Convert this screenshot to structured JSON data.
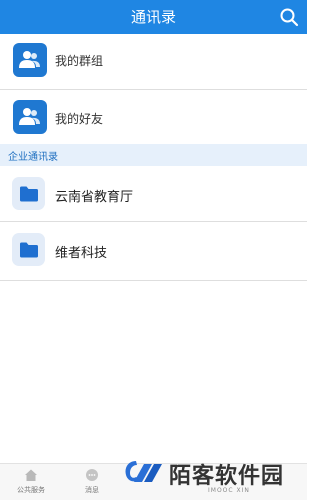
{
  "header": {
    "title": "通讯录",
    "search_icon": "search-icon"
  },
  "groups": [
    {
      "label": "我的群组",
      "icon": "contacts-icon"
    },
    {
      "label": "我的好友",
      "icon": "contacts-icon"
    }
  ],
  "section": {
    "label": "企业通讯录"
  },
  "orgs": [
    {
      "label": "云南省教育厅",
      "icon": "folder-icon"
    },
    {
      "label": "维者科技",
      "icon": "folder-icon"
    }
  ],
  "tabbar": {
    "tabs": [
      {
        "label": "公共服务",
        "icon": "home-icon"
      },
      {
        "label": "消息",
        "icon": "chat-icon"
      }
    ]
  },
  "watermark": {
    "text": "陌客软件园",
    "sub": "IMOOC XIN"
  },
  "colors": {
    "primary": "#1f86e3",
    "section_bg": "#e6f0fb",
    "folder_bg": "#e3ecf8"
  }
}
